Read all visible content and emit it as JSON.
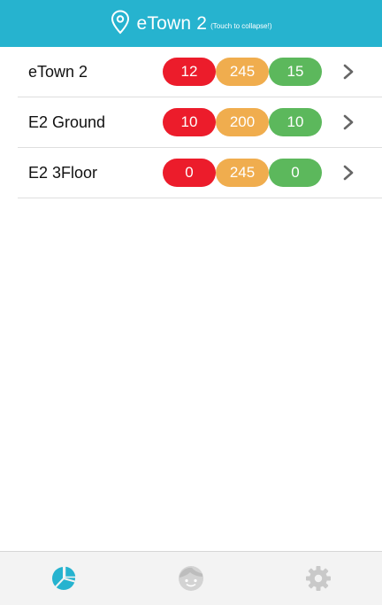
{
  "header": {
    "title": "eTown 2",
    "hint": "(Touch to collapse!)",
    "icon": "location-pin-icon",
    "color": "#26b3cf"
  },
  "rows": [
    {
      "name": "eTown 2",
      "red": "12",
      "orange": "245",
      "green": "15"
    },
    {
      "name": "E2 Ground",
      "red": "10",
      "orange": "200",
      "green": "10"
    },
    {
      "name": "E2 3Floor",
      "red": "0",
      "orange": "245",
      "green": "0"
    }
  ],
  "colors": {
    "red": "#ec1c2b",
    "orange": "#f0ad4e",
    "green": "#5cb85c"
  },
  "footer": {
    "tabs": [
      {
        "icon": "pie-chart-icon",
        "active": true
      },
      {
        "icon": "face-icon",
        "active": false
      },
      {
        "icon": "gear-icon",
        "active": false
      }
    ]
  }
}
